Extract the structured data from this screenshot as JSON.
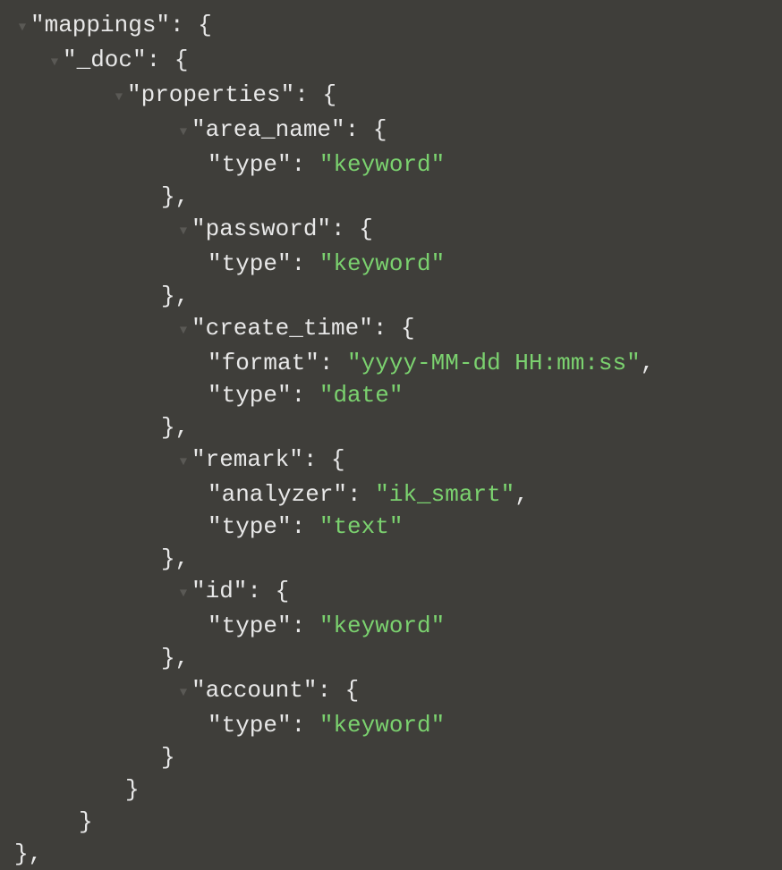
{
  "arrow_glyph": "▼",
  "lines": [
    {
      "level": 0,
      "arrow": true,
      "parts": [
        {
          "t": "key",
          "v": "\"mappings\""
        },
        {
          "t": "punc",
          "v": ": {"
        }
      ],
      "close": false
    },
    {
      "level": 1,
      "arrow": true,
      "parts": [
        {
          "t": "key",
          "v": "\"_doc\""
        },
        {
          "t": "punc",
          "v": ": {"
        }
      ],
      "close": false
    },
    {
      "level": 2,
      "arrow": true,
      "parts": [
        {
          "t": "key",
          "v": "\"properties\""
        },
        {
          "t": "punc",
          "v": ": {"
        }
      ],
      "close": false
    },
    {
      "level": 3,
      "arrow": true,
      "parts": [
        {
          "t": "key",
          "v": "\"area_name\""
        },
        {
          "t": "punc",
          "v": ": {"
        }
      ],
      "close": false
    },
    {
      "level": 4,
      "arrow": false,
      "parts": [
        {
          "t": "key",
          "v": "\"type\""
        },
        {
          "t": "punc",
          "v": ": "
        },
        {
          "t": "str",
          "v": "\"keyword\""
        }
      ],
      "close": false
    },
    {
      "level": 3,
      "arrow": false,
      "parts": [
        {
          "t": "punc",
          "v": "},"
        }
      ],
      "close": true
    },
    {
      "level": 3,
      "arrow": true,
      "parts": [
        {
          "t": "key",
          "v": "\"password\""
        },
        {
          "t": "punc",
          "v": ": {"
        }
      ],
      "close": false
    },
    {
      "level": 4,
      "arrow": false,
      "parts": [
        {
          "t": "key",
          "v": "\"type\""
        },
        {
          "t": "punc",
          "v": ": "
        },
        {
          "t": "str",
          "v": "\"keyword\""
        }
      ],
      "close": false
    },
    {
      "level": 3,
      "arrow": false,
      "parts": [
        {
          "t": "punc",
          "v": "},"
        }
      ],
      "close": true
    },
    {
      "level": 3,
      "arrow": true,
      "parts": [
        {
          "t": "key",
          "v": "\"create_time\""
        },
        {
          "t": "punc",
          "v": ": {"
        }
      ],
      "close": false
    },
    {
      "level": 4,
      "arrow": false,
      "parts": [
        {
          "t": "key",
          "v": "\"format\""
        },
        {
          "t": "punc",
          "v": ": "
        },
        {
          "t": "str",
          "v": "\"yyyy-MM-dd HH:mm:ss\""
        },
        {
          "t": "punc",
          "v": ","
        }
      ],
      "close": false
    },
    {
      "level": 4,
      "arrow": false,
      "parts": [
        {
          "t": "key",
          "v": "\"type\""
        },
        {
          "t": "punc",
          "v": ": "
        },
        {
          "t": "str",
          "v": "\"date\""
        }
      ],
      "close": false
    },
    {
      "level": 3,
      "arrow": false,
      "parts": [
        {
          "t": "punc",
          "v": "},"
        }
      ],
      "close": true
    },
    {
      "level": 3,
      "arrow": true,
      "parts": [
        {
          "t": "key",
          "v": "\"remark\""
        },
        {
          "t": "punc",
          "v": ": {"
        }
      ],
      "close": false
    },
    {
      "level": 4,
      "arrow": false,
      "parts": [
        {
          "t": "key",
          "v": "\"analyzer\""
        },
        {
          "t": "punc",
          "v": ": "
        },
        {
          "t": "str",
          "v": "\"ik_smart\""
        },
        {
          "t": "punc",
          "v": ","
        }
      ],
      "close": false
    },
    {
      "level": 4,
      "arrow": false,
      "parts": [
        {
          "t": "key",
          "v": "\"type\""
        },
        {
          "t": "punc",
          "v": ": "
        },
        {
          "t": "str",
          "v": "\"text\""
        }
      ],
      "close": false
    },
    {
      "level": 3,
      "arrow": false,
      "parts": [
        {
          "t": "punc",
          "v": "},"
        }
      ],
      "close": true
    },
    {
      "level": 3,
      "arrow": true,
      "parts": [
        {
          "t": "key",
          "v": "\"id\""
        },
        {
          "t": "punc",
          "v": ": {"
        }
      ],
      "close": false
    },
    {
      "level": 4,
      "arrow": false,
      "parts": [
        {
          "t": "key",
          "v": "\"type\""
        },
        {
          "t": "punc",
          "v": ": "
        },
        {
          "t": "str",
          "v": "\"keyword\""
        }
      ],
      "close": false
    },
    {
      "level": 3,
      "arrow": false,
      "parts": [
        {
          "t": "punc",
          "v": "},"
        }
      ],
      "close": true
    },
    {
      "level": 3,
      "arrow": true,
      "parts": [
        {
          "t": "key",
          "v": "\"account\""
        },
        {
          "t": "punc",
          "v": ": {"
        }
      ],
      "close": false
    },
    {
      "level": 4,
      "arrow": false,
      "parts": [
        {
          "t": "key",
          "v": "\"type\""
        },
        {
          "t": "punc",
          "v": ": "
        },
        {
          "t": "str",
          "v": "\"keyword\""
        }
      ],
      "close": false
    },
    {
      "level": 3,
      "arrow": false,
      "parts": [
        {
          "t": "punc",
          "v": "}"
        }
      ],
      "close": true
    },
    {
      "level": 2,
      "arrow": false,
      "parts": [
        {
          "t": "punc",
          "v": "}"
        }
      ],
      "close": true
    },
    {
      "level": 1,
      "arrow": false,
      "parts": [
        {
          "t": "punc",
          "v": "}"
        }
      ],
      "close": true
    },
    {
      "level": 0,
      "arrow": false,
      "parts": [
        {
          "t": "punc",
          "v": "},"
        }
      ],
      "close": true
    }
  ],
  "indent_close_offsets": {
    "0": 16,
    "1": 88,
    "2": 140,
    "3": 180,
    "4": 232
  }
}
